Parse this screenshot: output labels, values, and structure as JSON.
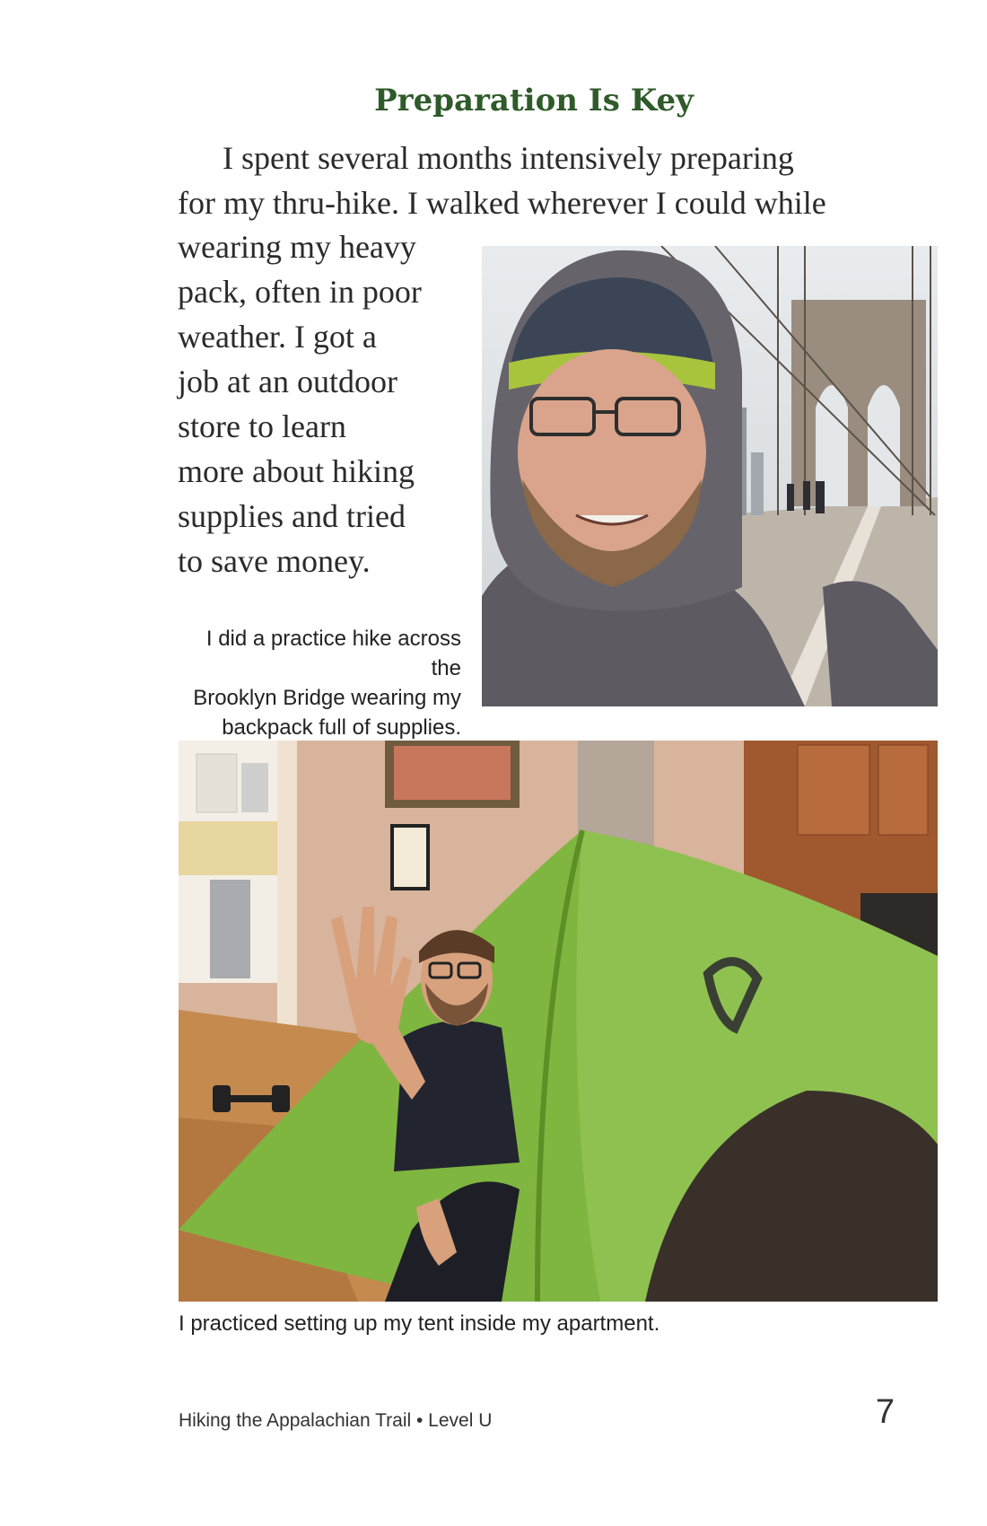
{
  "page": {
    "title": "Preparation Is Key",
    "paragraph_lines": [
      "I spent several months intensively preparing",
      "for my thru-hike. I walked wherever I could while",
      "wearing my heavy",
      "pack, often in poor",
      "weather. I got a",
      "job at an outdoor",
      "store to learn",
      "more about hiking",
      "supplies and tried",
      "to save money."
    ],
    "caption1_lines": [
      "I did a practice hike across the",
      "Brooklyn Bridge wearing my",
      "backpack full of supplies."
    ],
    "caption2": "I practiced setting up my tent inside my apartment.",
    "footer": "Hiking the Appalachian Trail • Level U",
    "page_number": "7"
  }
}
